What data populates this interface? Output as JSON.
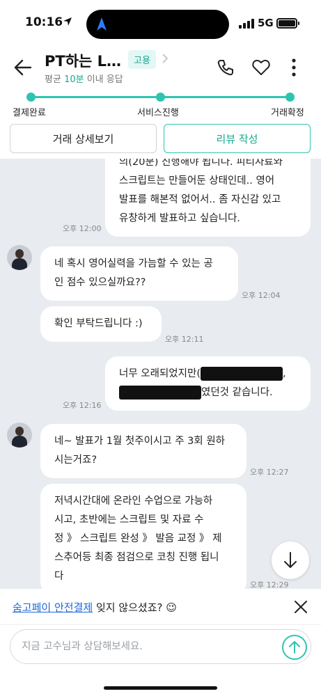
{
  "status_bar": {
    "time": "10:16",
    "network": "5G"
  },
  "header": {
    "title": "PT하는 L…",
    "badge": "고용",
    "response_prefix": "평균 ",
    "response_time": "10분",
    "response_suffix": " 이내 응답"
  },
  "progress": {
    "steps": [
      "결제완료",
      "서비스진행",
      "거래확정"
    ]
  },
  "actions": {
    "detail_label": "거래 상세보기",
    "review_label": "리뷰 작성"
  },
  "chat": {
    "messages": [
      {
        "lines": [
          "의(20분) 진행해야 됩니다. 피티자료와",
          "스크립트는 만들어둔 상태인데.. 영어",
          "발표를 해본적 없어서.. 좀 자신감 있고",
          "유창하게 발표하고 싶습니다."
        ],
        "time": "오후 12:00"
      },
      {
        "lines": [
          "네 혹시 영어실력을 가늠할 수 있는 공",
          "인 점수 있으실까요??"
        ],
        "time": "오후 12:04"
      },
      {
        "lines": [
          "확인 부탁드립니다 :)"
        ],
        "time": "오후 12:11"
      },
      {
        "line1_start": "너무 오래되었지만(",
        "line1_end": ",",
        "line2_end": "였던것 같습니다.",
        "time": "오후 12:16"
      },
      {
        "lines": [
          "네~ 발표가 1월 첫주이시고 주 3회 원하",
          "시는거죠?"
        ],
        "time": "오후 12:27"
      },
      {
        "lines": [
          "저녁시간대에 온라인 수업으로 가능하",
          "시고, 초반에는 스크립트 및 자료 수",
          "정 》 스크립트 완성 》 발음 교정 》 제",
          "스추어등 최종 점검으로 코칭 진행 됩니",
          "다"
        ],
        "time": "오후 12:29"
      }
    ]
  },
  "banner": {
    "link": "숨고페이 안전결제",
    "text": " 잊지 않으셨죠? 😉"
  },
  "composer": {
    "placeholder": "지금 고수님과 상담해보세요."
  },
  "colors": {
    "accent": "#2fc4b0",
    "link": "#1c67d8",
    "chat_bg": "#e8ebef"
  }
}
